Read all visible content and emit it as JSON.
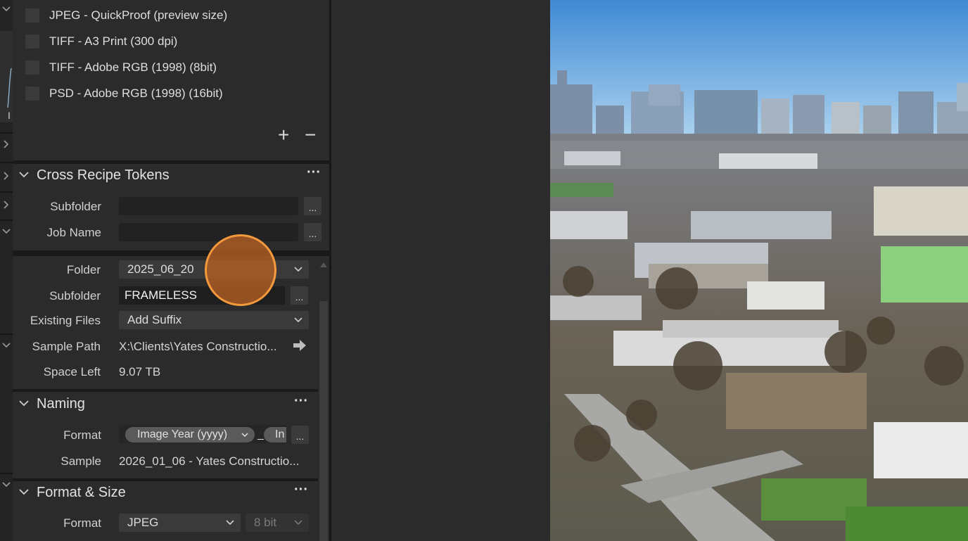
{
  "recipes": [
    {
      "label": "JPEG - QuickProof (preview size)"
    },
    {
      "label": "TIFF - A3 Print (300 dpi)"
    },
    {
      "label": "TIFF - Adobe RGB (1998) (8bit)"
    },
    {
      "label": "PSD - Adobe RGB (1998) (16bit)"
    }
  ],
  "recipe_controls": {
    "add": "+",
    "remove": "−"
  },
  "cross_recipe": {
    "title": "Cross Recipe Tokens",
    "more": "···",
    "subfolder_label": "Subfolder",
    "subfolder_value": "",
    "job_name_label": "Job Name",
    "job_name_value": "",
    "dots": "..."
  },
  "location": {
    "folder_label": "Folder",
    "folder_value": "2025_06_20",
    "subfolder_label": "Subfolder",
    "subfolder_value": "FRAMELESS",
    "existing_label": "Existing Files",
    "existing_value": "Add Suffix",
    "sample_path_label": "Sample Path",
    "sample_path_value": "X:\\Clients\\Yates Constructio...",
    "space_left_label": "Space Left",
    "space_left_value": "9.07 TB",
    "dots": "..."
  },
  "naming": {
    "title": "Naming",
    "more": "···",
    "format_label": "Format",
    "token1": "Image Year (yyyy)",
    "separator": "_",
    "token2": "In",
    "sample_label": "Sample",
    "sample_value": "2026_01_06 - Yates Constructio...",
    "dots": "..."
  },
  "format_size": {
    "title": "Format & Size",
    "more": "···",
    "format_label": "Format",
    "format_value": "JPEG",
    "bit_value": "8 bit"
  },
  "strip": {
    "letter": "I"
  },
  "colors": {
    "panel": "#2b2b2b",
    "cursor": "#f59a3c",
    "sky": "#4f96d6"
  }
}
